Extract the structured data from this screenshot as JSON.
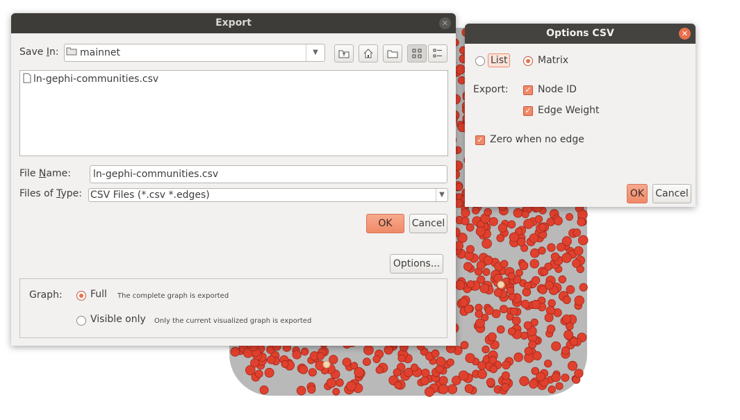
{
  "export_dialog": {
    "title": "Export",
    "save_in_label": "Save In:",
    "save_in_value": "mainnet",
    "files": [
      "ln-gephi-communities.csv"
    ],
    "file_name_label": "File Name:",
    "file_name_value": "ln-gephi-communities.csv",
    "files_of_type_label": "Files of Type:",
    "files_of_type_value": "CSV Files (*.csv *.edges)",
    "ok_label": "OK",
    "cancel_label": "Cancel",
    "options_label": "Options...",
    "graph_label": "Graph:",
    "graph_full_label": "Full",
    "graph_full_desc": "The complete graph is exported",
    "graph_visible_label": "Visible only",
    "graph_visible_desc": "Only the current visualized graph is exported",
    "graph_selected": "Full"
  },
  "options_dialog": {
    "title": "Options CSV",
    "format_list_label": "List",
    "format_matrix_label": "Matrix",
    "format_selected": "Matrix",
    "export_label": "Export:",
    "node_id_label": "Node ID",
    "node_id_checked": true,
    "edge_weight_label": "Edge Weight",
    "edge_weight_checked": true,
    "zero_when_no_edge_label": "Zero when no edge",
    "zero_when_no_edge_checked": true,
    "ok_label": "OK",
    "cancel_label": "Cancel"
  },
  "colors": {
    "accent": "#ef8a68",
    "titlebar": "#3e3c38",
    "node_fill": "#e0412e",
    "node_highlight": "#f5d7b0"
  }
}
